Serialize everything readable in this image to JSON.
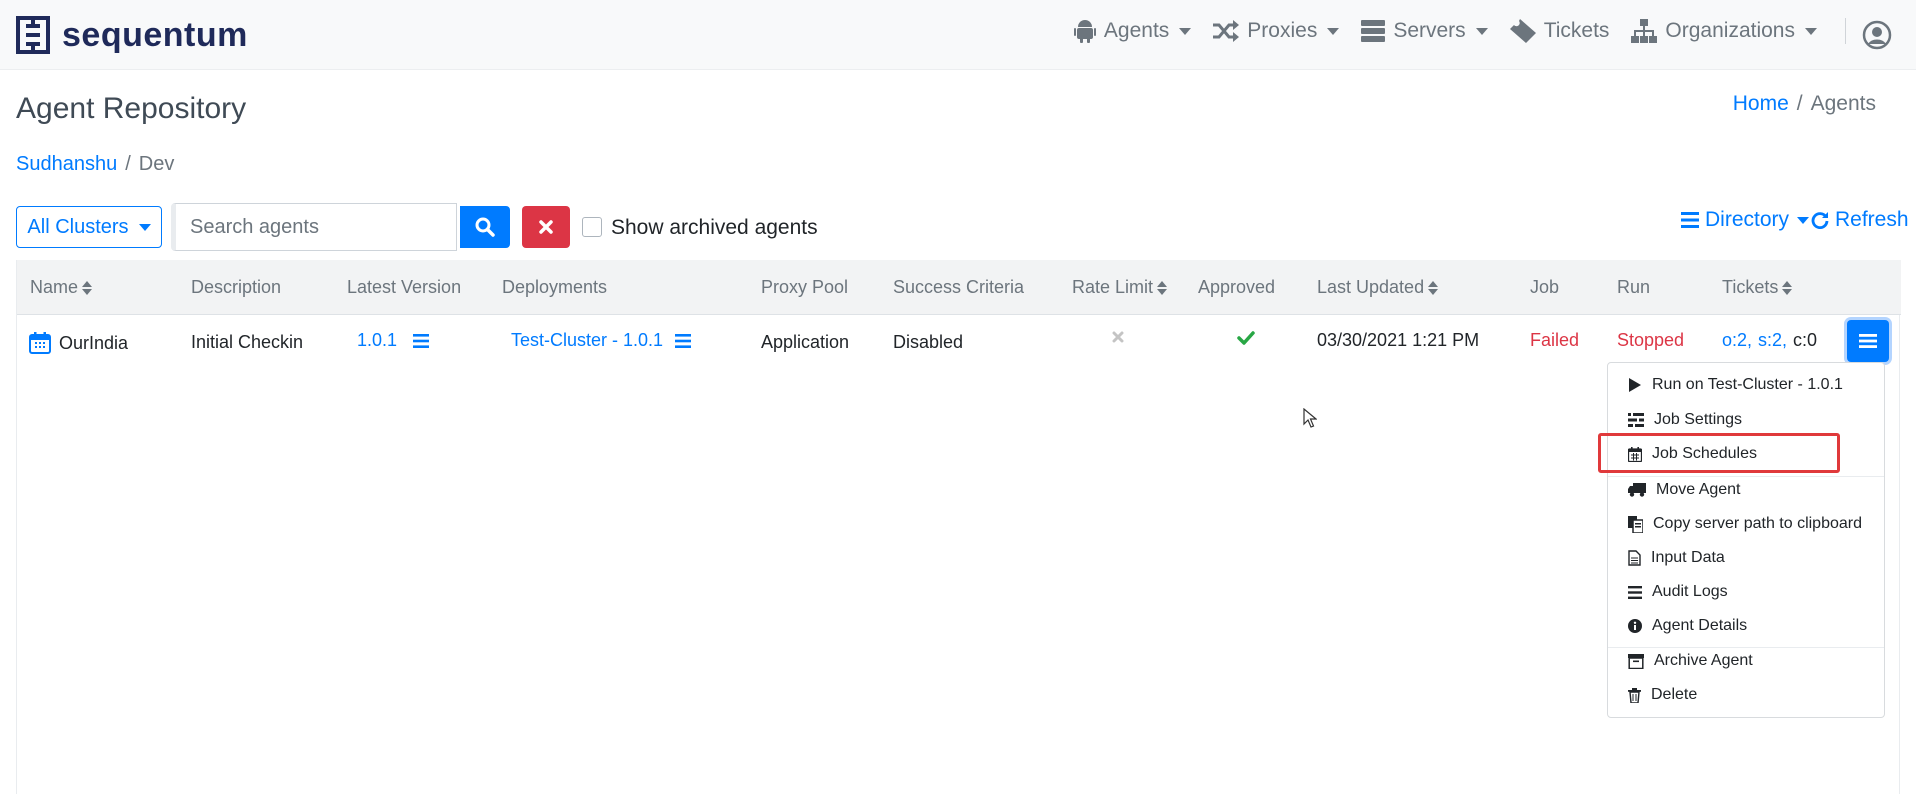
{
  "brand": {
    "name": "sequentum",
    "color": "#1f2a5a"
  },
  "nav": {
    "items": [
      {
        "label": "Agents",
        "icon": "android-icon",
        "dropdown": true
      },
      {
        "label": "Proxies",
        "icon": "shuffle-icon",
        "dropdown": true
      },
      {
        "label": "Servers",
        "icon": "server-icon",
        "dropdown": true
      },
      {
        "label": "Tickets",
        "icon": "ticket-icon",
        "dropdown": false
      },
      {
        "label": "Organizations",
        "icon": "sitemap-icon",
        "dropdown": true
      }
    ],
    "user_icon": "user-circle-icon"
  },
  "page": {
    "title": "Agent Repository",
    "breadcrumb": {
      "home": "Home",
      "current": "Agents"
    },
    "path": {
      "org": "Sudhanshu",
      "folder": "Dev"
    }
  },
  "toolbar": {
    "clusters_label": "All Clusters",
    "search_placeholder": "Search agents",
    "search_value": "",
    "show_archived_label": "Show archived agents",
    "show_archived_checked": false,
    "directory_label": "Directory",
    "refresh_label": "Refresh"
  },
  "table": {
    "columns": [
      "Name",
      "Description",
      "Latest Version",
      "Deployments",
      "Proxy Pool",
      "Success Criteria",
      "Rate Limit",
      "Approved",
      "Last Updated",
      "Job",
      "Run",
      "Tickets"
    ],
    "sortable": [
      "Name",
      "Rate Limit",
      "Last Updated",
      "Tickets"
    ],
    "rows": [
      {
        "name": "OurIndia",
        "description": "Initial Checkin",
        "latest_version": "1.0.1",
        "deployment": "Test-Cluster - 1.0.1",
        "proxy_pool": "Application",
        "success_criteria": "Disabled",
        "rate_limit": "none",
        "approved": true,
        "last_updated": "03/30/2021 1:21 PM",
        "job": "Failed",
        "run": "Stopped",
        "tickets_open": "o:2,",
        "tickets_s": "s:2,",
        "tickets_c": "c:0"
      }
    ]
  },
  "actions_menu": {
    "items": [
      {
        "label": "Run on Test-Cluster - 1.0.1",
        "icon": "play-icon"
      },
      {
        "label": "Job Settings",
        "icon": "settings-list-icon"
      },
      {
        "label": "Job Schedules",
        "icon": "calendar-icon",
        "highlighted": true
      },
      {
        "label": "Move Agent",
        "icon": "truck-icon"
      },
      {
        "label": "Copy server path to clipboard",
        "icon": "copy-icon"
      },
      {
        "label": "Input Data",
        "icon": "file-icon"
      },
      {
        "label": "Audit Logs",
        "icon": "list-icon"
      },
      {
        "label": "Agent Details",
        "icon": "info-icon"
      },
      {
        "label": "Archive Agent",
        "icon": "archive-icon"
      },
      {
        "label": "Delete",
        "icon": "trash-icon"
      }
    ]
  },
  "colors": {
    "primary": "#007bff",
    "danger": "#dc3545",
    "success": "#28a745",
    "highlight": "#e0393b"
  }
}
